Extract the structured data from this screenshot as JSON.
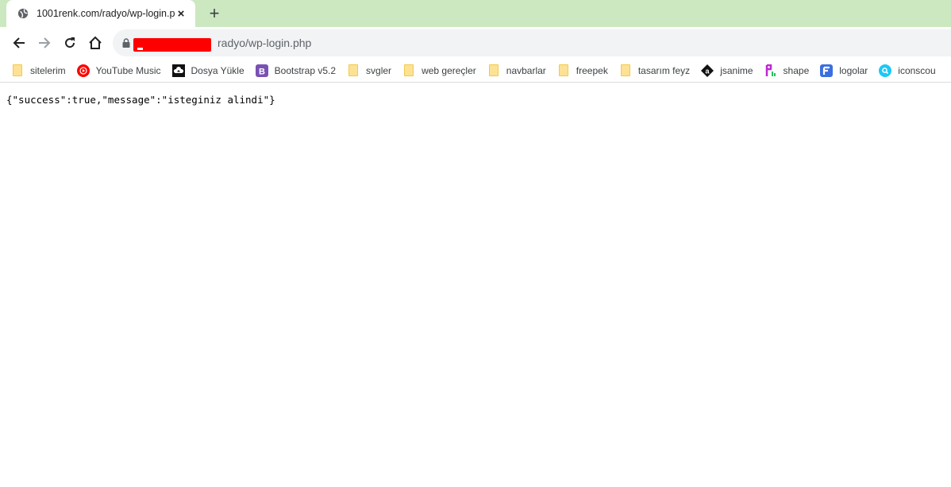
{
  "tab": {
    "title": "1001renk.com/radyo/wp-login.p",
    "favicon": "globe-icon",
    "close": "×"
  },
  "new_tab": "+",
  "toolbar": {
    "back": "back-icon",
    "forward": "forward-icon",
    "reload": "reload-icon",
    "home": "home-icon"
  },
  "omnibox": {
    "url_visible": "radyo/wp-login.php",
    "redacted": true
  },
  "bookmarks": [
    {
      "label": "sitelerim",
      "icon": "folder"
    },
    {
      "label": "YouTube Music",
      "icon": "youtube-music"
    },
    {
      "label": "Dosya Yükle",
      "icon": "upload-cloud"
    },
    {
      "label": "Bootstrap v5.2",
      "icon": "bootstrap"
    },
    {
      "label": "svgler",
      "icon": "folder"
    },
    {
      "label": "web gereçler",
      "icon": "folder"
    },
    {
      "label": "navbarlar",
      "icon": "folder"
    },
    {
      "label": "freepek",
      "icon": "folder"
    },
    {
      "label": "tasarım feyz",
      "icon": "folder"
    },
    {
      "label": "jsanime",
      "icon": "jsanime"
    },
    {
      "label": "shape",
      "icon": "shape"
    },
    {
      "label": "logolar",
      "icon": "logolar"
    },
    {
      "label": "iconscou",
      "icon": "iconscout"
    }
  ],
  "page": {
    "body_text": "{\"success\":true,\"message\":\"isteginiz alindi\"}"
  },
  "colors": {
    "tabstrip": "#cce8c0",
    "omnibox": "#f1f3f4",
    "folder": "#fde293",
    "redaction": "#ff0000"
  }
}
